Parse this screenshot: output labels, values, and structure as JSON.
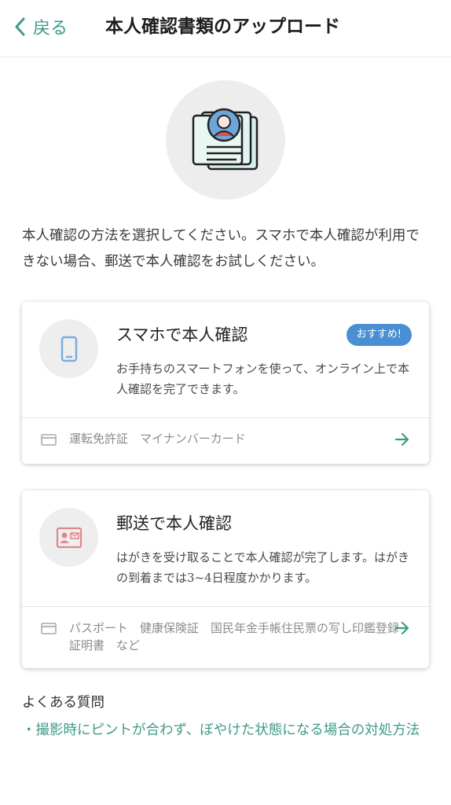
{
  "header": {
    "back_label": "戻る",
    "title": "本人確認書類のアップロード"
  },
  "hero": {
    "icon": "id-documents-icon"
  },
  "intro_text": "本人確認の方法を選択してください。スマホで本人確認が利用できない場合、郵送で本人確認をお試しください。",
  "options": [
    {
      "icon": "smartphone-icon",
      "title": "スマホで本人確認",
      "badge": "おすすめ!",
      "description": "お手持ちのスマートフォンを使って、オンライン上で本人確認を完了できます。",
      "documents": "運転免許証　マイナンバーカード"
    },
    {
      "icon": "id-card-mail-icon",
      "title": "郵送で本人確認",
      "description": "はがきを受け取ることで本人確認が完了します。はがきの到着までは3~4日程度かかります。",
      "documents": "パスポート　健康保険証　国民年金手帳住民票の写し印鑑登録証明書　など"
    }
  ],
  "faq": {
    "heading": "よくある質問",
    "links": [
      "・撮影時にピントが合わず、ぼやけた状態になる場合の対処方法"
    ]
  },
  "colors": {
    "accent": "#3f9a87",
    "badge": "#4a8fd3",
    "phone_icon": "#7aaede",
    "mail_icon": "#e08888"
  }
}
